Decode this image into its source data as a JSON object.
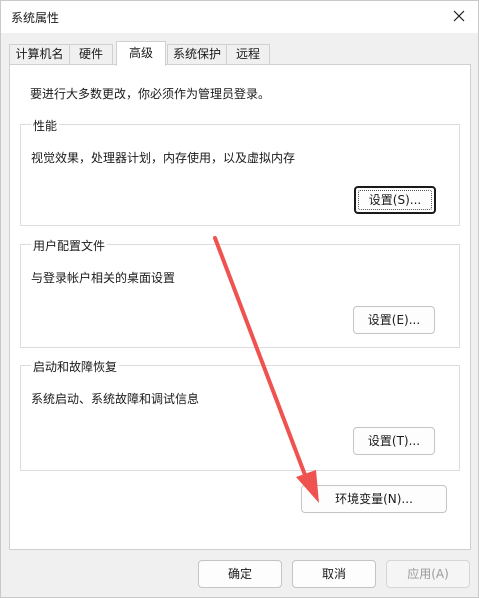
{
  "window": {
    "title": "系统属性"
  },
  "tabs": [
    {
      "label": "计算机名",
      "active": false
    },
    {
      "label": "硬件",
      "active": false
    },
    {
      "label": "高级",
      "active": true
    },
    {
      "label": "系统保护",
      "active": false
    },
    {
      "label": "远程",
      "active": false
    }
  ],
  "notice": "要进行大多数更改，你必须作为管理员登录。",
  "groups": {
    "performance": {
      "title": "性能",
      "desc": "视觉效果，处理器计划，内存使用，以及虚拟内存",
      "button": "设置(S)..."
    },
    "profiles": {
      "title": "用户配置文件",
      "desc": "与登录帐户相关的桌面设置",
      "button": "设置(E)..."
    },
    "startup": {
      "title": "启动和故障恢复",
      "desc": "系统启动、系统故障和调试信息",
      "button": "设置(T)..."
    }
  },
  "env_button": "环境变量(N)...",
  "footer": {
    "ok": "确定",
    "cancel": "取消",
    "apply": "应用(A)"
  },
  "colors": {
    "arrow": "#f0524f",
    "accent": "#1a1a1a"
  }
}
